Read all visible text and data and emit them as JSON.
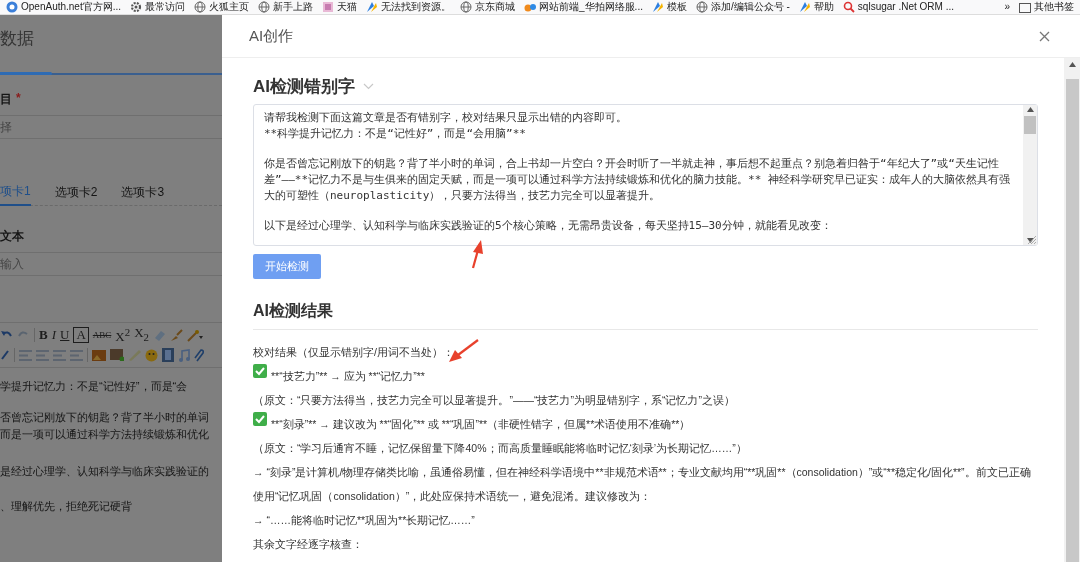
{
  "bookmarks": {
    "items": [
      {
        "label": "OpenAuth.net官方网..."
      },
      {
        "label": "最常访问"
      },
      {
        "label": "火狐主页"
      },
      {
        "label": "新手上路"
      },
      {
        "label": "天猫"
      },
      {
        "label": "无法找到资源。"
      },
      {
        "label": "京东商城"
      },
      {
        "label": "网站前端_华拍网络服..."
      },
      {
        "label": "模板"
      },
      {
        "label": "添加/编辑公众号 -"
      },
      {
        "label": "帮助"
      },
      {
        "label": "sqlsugar .Net ORM ..."
      }
    ],
    "overflow": "»",
    "other": "其他书签"
  },
  "background_page": {
    "title": "数据",
    "field_label": "目",
    "required_mark": "*",
    "select_placeholder": "择",
    "tabs": [
      {
        "label": "项卡1",
        "selected": true
      },
      {
        "label": "选项卡2",
        "selected": false
      },
      {
        "label": "选项卡3",
        "selected": false
      }
    ],
    "text_label": "文本",
    "text_placeholder": "输入",
    "toolbar_buttons": [
      {
        "label": "B",
        "kind": "bold"
      },
      {
        "label": "I",
        "kind": "italic"
      },
      {
        "label": "U",
        "kind": "underline"
      },
      {
        "label": "A",
        "kind": "boxed"
      },
      {
        "label": "ABC",
        "kind": "strike"
      },
      {
        "label": "X$^{2}$",
        "kind": "plain"
      },
      {
        "label": "X$_{2}$",
        "kind": "plain"
      }
    ],
    "editor_lines": [
      "学提升记忆力：不是“记性好”，而是“会",
      "否曾忘记刚放下的钥匙？背了半小时的单词",
      "而是一项可以通过科学方法持续锻炼和优化",
      "是经过心理学、认知科学与临床实践验证的",
      "、理解优先，拒绝死记硬背"
    ]
  },
  "dialog": {
    "title": "AI创作",
    "section_title": "AI检测错别字",
    "prompt_paragraphs": [
      "请帮我检测下面这篇文章是否有错别字，校对结果只显示出错的内容即可。",
      "**科学提升记忆力：不是“记性好”，而是“会用脑”**",
      "你是否曾忘记刚放下的钥匙？背了半小时的单词，合上书却一片空白？开会时听了一半就走神，事后想不起重点？别急着归咎于“年纪大了”或“天生记性差”——**记忆力不是与生俱来的固定天赋，而是一项可以通过科学方法持续锻炼和优化的脑力技能。** 神经科学研究早已证实：成年人的大脑依然具有强大的可塑性（neuroplasticity），只要方法得当，技艺力完全可以显著提升。",
      "以下是经过心理学、认知科学与临床实践验证的5个核心策略，无需昂贵设备，每天坚持15–30分钟，就能看见改变："
    ],
    "start_button": "开始检测",
    "result_title": "AI检测结果",
    "result_lines": [
      {
        "kind": "text",
        "text": "校对结果（仅显示错别字/用词不当处）："
      },
      {
        "kind": "check",
        "text": "**“技艺力”** → 应为 **“记忆力”**"
      },
      {
        "kind": "text",
        "text": "（原文：“只要方法得当，技艺力完全可以显著提升。”——“技艺力”为明显错别字，系“记忆力”之误）"
      },
      {
        "kind": "check",
        "text": "**“刻录”** → 建议改为 **“固化”** 或 **“巩固”**（非硬性错字，但属**术语使用不准确**）"
      },
      {
        "kind": "text",
        "text": "（原文：“学习后通宵不睡，记忆保留量下降40%；而高质量睡眠能将临时记忆‘刻录’为长期记忆……”）"
      },
      {
        "kind": "text",
        "text": "→ “刻录”是计算机/物理存储类比喻，虽通俗易懂，但在神经科学语境中**非规范术语**；专业文献均用“**巩固**（consolidation）”或“**稳定化/固化**”。前文已正确使用“记忆巩固（consolidation）”，此处应保持术语统一，避免混淆。建议修改为："
      },
      {
        "kind": "text",
        "text": "→ “……能将临时记忆**巩固为**长期记忆……”"
      },
      {
        "kind": "text",
        "text": "其余文字经逐字核查："
      }
    ]
  }
}
